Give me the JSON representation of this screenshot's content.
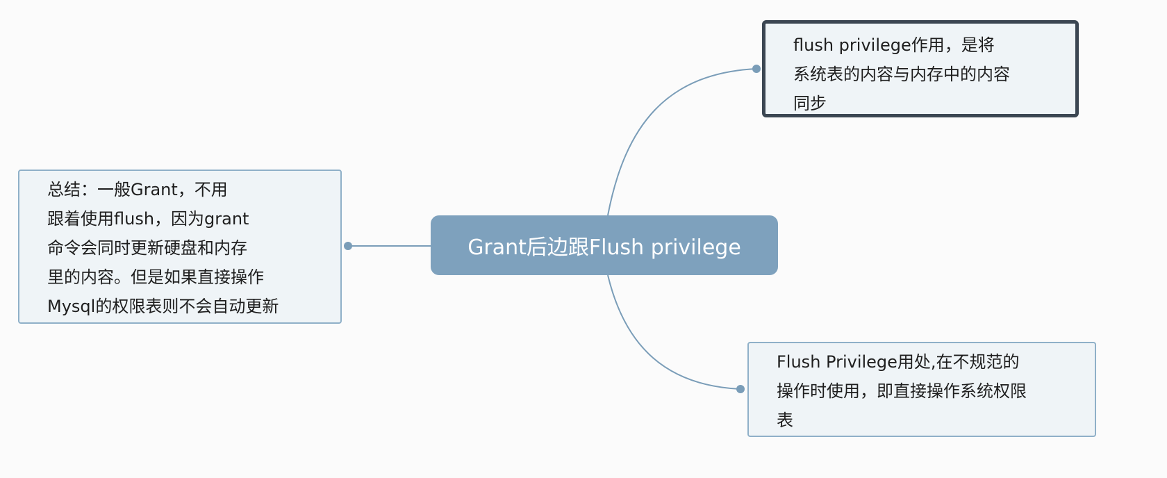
{
  "colors": {
    "background": "#fbfbfb",
    "central_fill": "#7ea1bd",
    "node_fill": "#eff4f7",
    "node_border": "#8fb0c8",
    "selected_border": "#3b4652",
    "connector": "#7a9db8"
  },
  "central": {
    "label": "Grant后边跟Flush privilege"
  },
  "nodes": {
    "top_right": {
      "lines": [
        "flush privilege作用，是将",
        "系统表的内容与内存中的内容",
        "同步"
      ]
    },
    "left": {
      "lines": [
        "总结：一般Grant，不用",
        "跟着使用flush，因为grant",
        "命令会同时更新硬盘和内存",
        "里的内容。但是如果直接操作",
        "Mysql的权限表则不会自动更新"
      ]
    },
    "bottom_right": {
      "lines": [
        "Flush Privilege用处,在不规范的",
        "操作时使用，即直接操作系统权限",
        "表"
      ]
    }
  }
}
